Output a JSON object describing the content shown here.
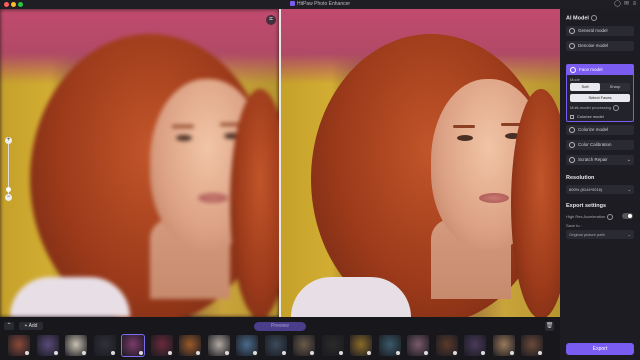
{
  "window": {
    "title": "HitPaw Photo Enhancer"
  },
  "sidebar": {
    "ai_model_title": "AI Model",
    "models": [
      {
        "label": "General model",
        "icon": "general-model-icon"
      },
      {
        "label": "Denoise model",
        "icon": "denoise-model-icon"
      }
    ],
    "face_model": {
      "label": "Face model",
      "mode_label": "Mode",
      "mode_options": [
        "Soft",
        "Sharp"
      ],
      "mode_selected": "Soft",
      "select_faces_label": "Select Faces",
      "multi_model_label": "Multi-model processing",
      "colorize_checkbox_label": "Colorize model",
      "colorize_checked": false
    },
    "more_models": [
      {
        "label": "Colorize model",
        "icon": "colorize-model-icon"
      },
      {
        "label": "Color Calibration",
        "icon": "color-calibration-icon"
      },
      {
        "label": "Scratch Repair",
        "icon": "scratch-repair-icon"
      }
    ],
    "resolution_title": "Resolution",
    "resolution_value": "800% (8144*9216)",
    "export_settings_title": "Export settings",
    "hw_accel_label": "High Res Acceleration",
    "hw_accel_on": false,
    "save_to_label": "Save to :",
    "save_to_value": "Original picture path",
    "export_label": "Export"
  },
  "bottom_bar": {
    "add_label": "Add",
    "preview_label": "Preview"
  },
  "thumbnails_count": 19,
  "colors": {
    "accent": "#7b5cf0",
    "panel": "#1c1c22"
  }
}
